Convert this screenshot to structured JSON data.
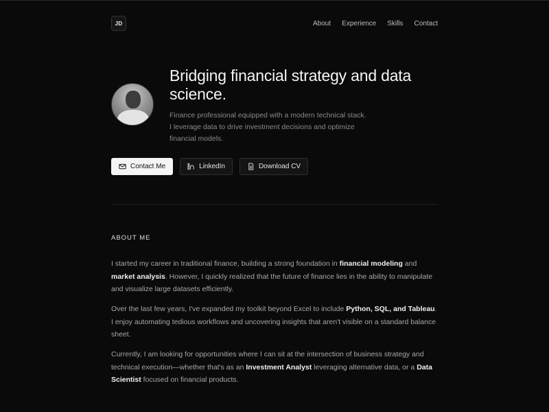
{
  "nav": {
    "logo": "JD",
    "links": [
      "About",
      "Experience",
      "Skills",
      "Contact"
    ]
  },
  "hero": {
    "headline": "Bridging financial strategy and data science.",
    "subtitle": "Finance professional equipped with a modern technical stack. I leverage data to drive investment decisions and optimize financial models."
  },
  "actions": {
    "contact": "Contact Me",
    "linkedin": "LinkedIn",
    "cv": "Download CV"
  },
  "about": {
    "title": "ABOUT ME",
    "p1": {
      "a": "I started my career in traditional finance, building a strong foundation in ",
      "b1": "financial modeling",
      "c": " and ",
      "b2": "market analysis",
      "d": ". However, I quickly realized that the future of finance lies in the ability to manipulate and visualize large datasets efficiently."
    },
    "p2": {
      "a": "Over the last few years, I've expanded my toolkit beyond Excel to include ",
      "b1": "Python, SQL, and Tableau",
      "c": ". I enjoy automating tedious workflows and uncovering insights that aren't visible on a standard balance sheet."
    },
    "p3": {
      "a": "Currently, I am looking for opportunities where I can sit at the intersection of business strategy and technical execution—whether that's as an ",
      "b1": "Investment Analyst",
      "c": " leveraging alternative data, or a ",
      "b2": "Data Scientist",
      "d": " focused on financial products."
    }
  },
  "colors": {
    "background": "#0a0a0a",
    "primary_button": "#f5f5f5",
    "text_muted": "#a8a8a8"
  },
  "icons": [
    "mail-icon",
    "linkedin-icon",
    "document-icon"
  ]
}
